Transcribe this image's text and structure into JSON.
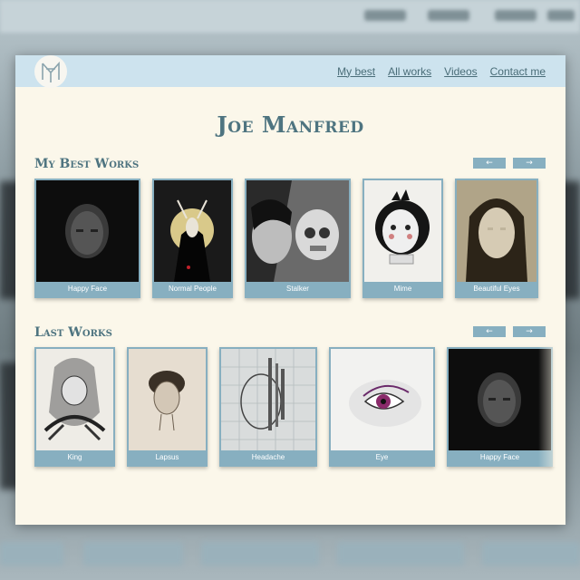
{
  "nav": {
    "links": [
      "My best",
      "All works",
      "Videos",
      "Contact me"
    ]
  },
  "site_title": "Joe Manfred",
  "sections": [
    {
      "title": "My Best Works",
      "prev_icon": "arrow-left-icon",
      "next_icon": "arrow-right-icon",
      "items": [
        "Happy Face",
        "Normal People",
        "Stalker",
        "Mime",
        "Beautiful Eyes"
      ]
    },
    {
      "title": "Last Works",
      "prev_icon": "arrow-left-icon",
      "next_icon": "arrow-right-icon",
      "items": [
        "King",
        "Lapsus",
        "Headache",
        "Eye",
        "Happy Face"
      ]
    }
  ],
  "colors": {
    "navbar": "#cde3ee",
    "page": "#fbf7ea",
    "accent": "#87afc0",
    "title": "#4e7480"
  }
}
